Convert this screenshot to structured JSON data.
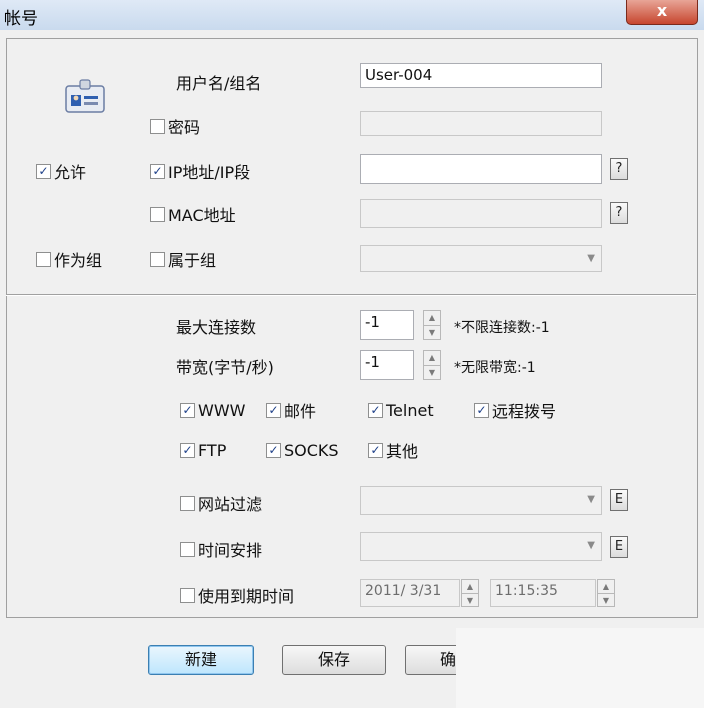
{
  "window": {
    "title": "帐号",
    "close_glyph": "x"
  },
  "account": {
    "username_label": "用户名/组名",
    "username_value": "User-004",
    "password_label": "密码",
    "password_checked": false,
    "allow_label": "允许",
    "allow_checked": true,
    "ip_label": "IP地址/IP段",
    "ip_checked": true,
    "mac_label": "MAC地址",
    "mac_checked": false,
    "as_group_label": "作为组",
    "as_group_checked": false,
    "belongs_group_label": "属于组",
    "belongs_group_checked": false,
    "help_glyph": "?"
  },
  "limits": {
    "max_conn_label": "最大连接数",
    "max_conn_value": "-1",
    "max_conn_hint": "*不限连接数:-1",
    "bandwidth_label": "带宽(字节/秒)",
    "bandwidth_value": "-1",
    "bandwidth_hint": "*无限带宽:-1"
  },
  "services": [
    {
      "label": "WWW",
      "checked": true
    },
    {
      "label": "邮件",
      "checked": true
    },
    {
      "label": "Telnet",
      "checked": true
    },
    {
      "label": "远程拨号",
      "checked": true
    },
    {
      "label": "FTP",
      "checked": true
    },
    {
      "label": "SOCKS",
      "checked": true
    },
    {
      "label": "其他",
      "checked": true
    }
  ],
  "filters": {
    "site_filter_label": "网站过滤",
    "schedule_label": "时间安排",
    "expiry_label": "使用到期时间",
    "expiry_date": "2011/  3/31",
    "expiry_time": "11:15:35",
    "edit_glyph": "E"
  },
  "buttons": {
    "new_label": "新建",
    "save_label": "保存",
    "ok_label": "确"
  },
  "colors": {
    "check_mark": "#1d3f88",
    "close_button": "#c7462f"
  }
}
